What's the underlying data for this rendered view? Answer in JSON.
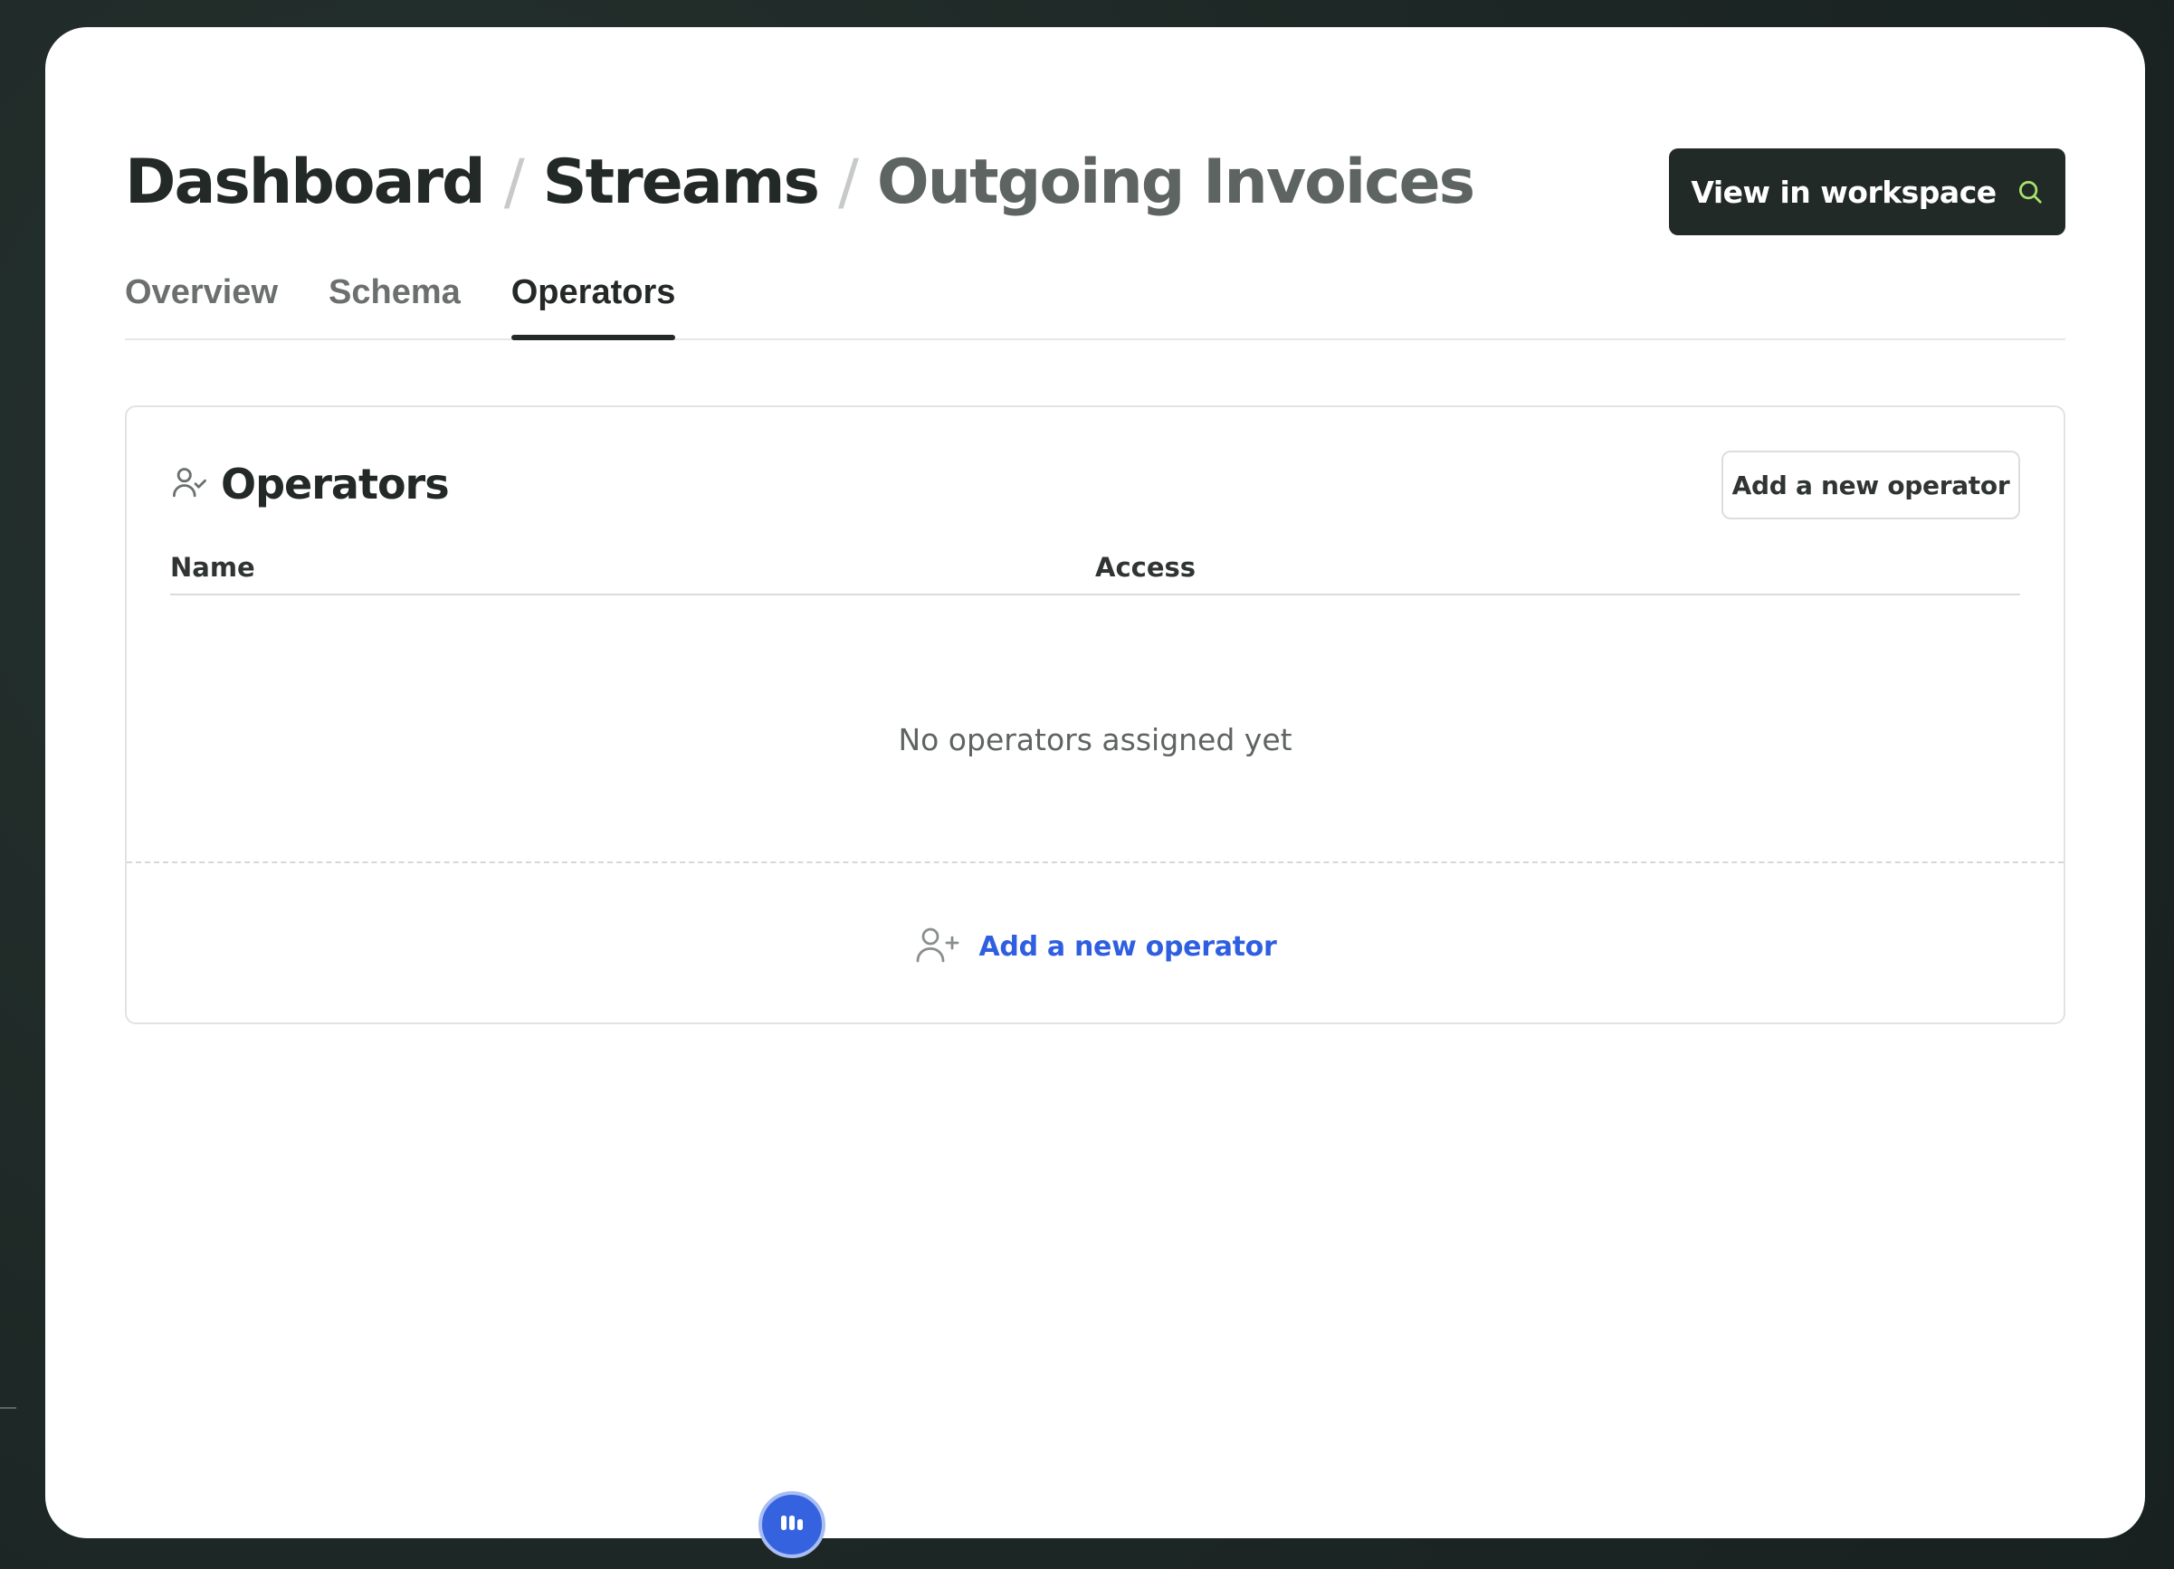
{
  "breadcrumb": {
    "items": [
      "Dashboard",
      "Streams",
      "Outgoing Invoices"
    ],
    "separator": "/"
  },
  "header": {
    "workspace_button_label": "View in workspace",
    "workspace_button_icon": "search-icon",
    "accent_color": "#a6e36b"
  },
  "tabs": [
    {
      "label": "Overview",
      "active": false
    },
    {
      "label": "Schema",
      "active": false
    },
    {
      "label": "Operators",
      "active": true
    }
  ],
  "card": {
    "title": "Operators",
    "title_icon": "user-check-icon",
    "add_button_label": "Add a new operator",
    "columns": [
      "Name",
      "Access"
    ],
    "rows": [],
    "empty_message": "No operators assigned yet",
    "add_link_label": "Add a new operator",
    "add_link_icon": "user-plus-icon",
    "link_color": "#2f5fe0"
  },
  "fab": {
    "icon": "equalizer-icon",
    "color": "#3563e0"
  }
}
